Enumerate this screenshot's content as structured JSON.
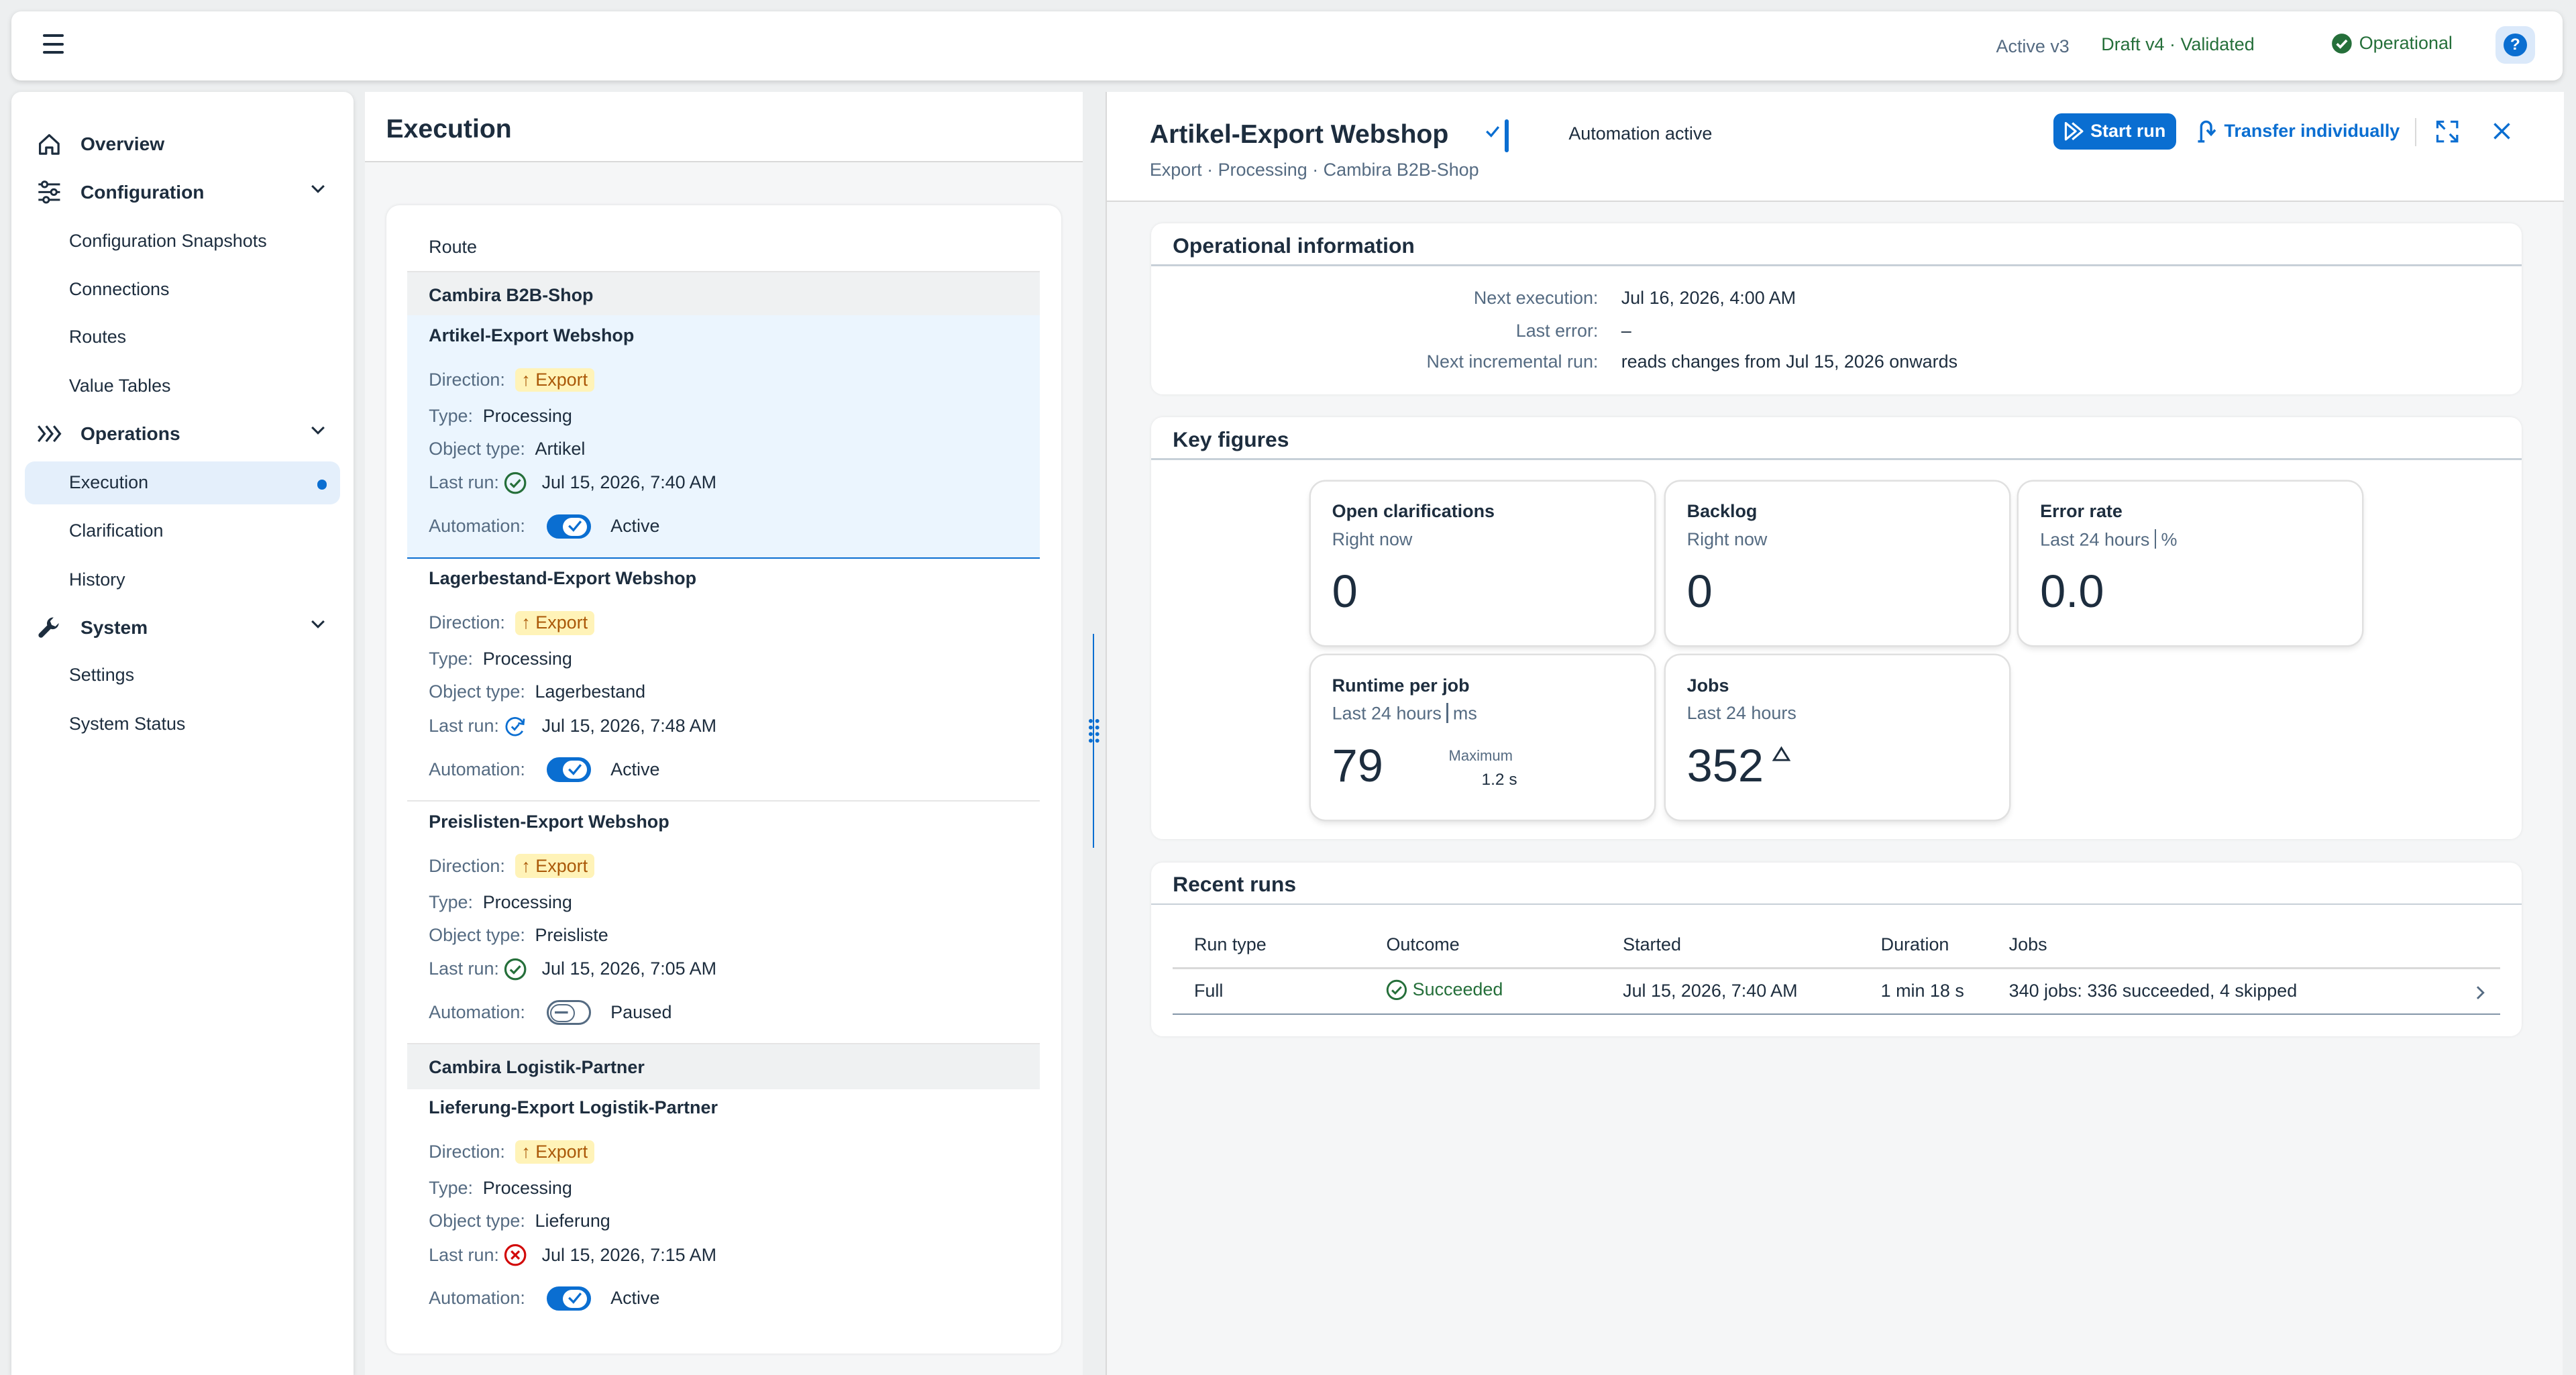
{
  "shell": {
    "active_version": "Active v3",
    "draft_version": "Draft v4 · Validated",
    "system_status": "Operational",
    "help": "?"
  },
  "nav": {
    "overview": "Overview",
    "configuration": "Configuration",
    "configuration_snapshots": "Configuration Snapshots",
    "connections": "Connections",
    "routes": "Routes",
    "value_tables": "Value Tables",
    "operations": "Operations",
    "execution": "Execution",
    "clarification": "Clarification",
    "history": "History",
    "system": "System",
    "settings": "Settings",
    "system_status": "System Status"
  },
  "execution": {
    "title": "Execution",
    "column_header": "Route",
    "labels": {
      "direction": "Direction:",
      "type": "Type:",
      "object_type": "Object type:",
      "last_run": "Last run:",
      "automation": "Automation:"
    },
    "groups": [
      {
        "name": "Cambira B2B-Shop",
        "routes": [
          {
            "title": "Artikel-Export Webshop",
            "direction": "↑ Export",
            "type": "Processing",
            "object_type": "Artikel",
            "last_run": "Jul 15, 2026, 7:40 AM",
            "last_run_status": "success",
            "automation": "Active"
          },
          {
            "title": "Lagerbestand-Export Webshop",
            "direction": "↑ Export",
            "type": "Processing",
            "object_type": "Lagerbestand",
            "last_run": "Jul 15, 2026, 7:48 AM",
            "last_run_status": "running",
            "automation": "Active"
          },
          {
            "title": "Preislisten-Export Webshop",
            "direction": "↑ Export",
            "type": "Processing",
            "object_type": "Preisliste",
            "last_run": "Jul 15, 2026, 7:05 AM",
            "last_run_status": "success",
            "automation": "Paused"
          }
        ]
      },
      {
        "name": "Cambira Logistik-Partner",
        "routes": [
          {
            "title": "Lieferung-Export Logistik-Partner",
            "direction": "↑ Export",
            "type": "Processing",
            "object_type": "Lieferung",
            "last_run": "Jul 15, 2026, 7:15 AM",
            "last_run_status": "error",
            "automation": "Active"
          }
        ]
      }
    ]
  },
  "detail": {
    "title": "Artikel-Export Webshop",
    "automation_label": "Automation active",
    "subtitle": "Export · Processing · Cambira B2B-Shop",
    "start_run": "Start run",
    "transfer_individually": "Transfer individually",
    "operational": {
      "title": "Operational information",
      "next_execution_label": "Next execution:",
      "next_execution": "Jul 16, 2026, 4:00 AM",
      "last_error_label": "Last error:",
      "last_error": "–",
      "next_incremental_label": "Next incremental run:",
      "next_incremental": "reads changes from Jul 15, 2026 onwards"
    },
    "key_figures": {
      "title": "Key figures",
      "open_clarifications": {
        "title": "Open clarifications",
        "sub": "Right now",
        "value": "0"
      },
      "backlog": {
        "title": "Backlog",
        "sub": "Right now",
        "value": "0"
      },
      "error_rate": {
        "title": "Error rate",
        "sub": "Last 24 hours",
        "unit": "%",
        "value": "0.0"
      },
      "runtime": {
        "title": "Runtime per job",
        "sub": "Last 24 hours",
        "unit": "ms",
        "value": "79",
        "max_label": "Maximum",
        "max_value": "1.2 s"
      },
      "jobs": {
        "title": "Jobs",
        "sub": "Last 24 hours",
        "value": "352",
        "trend": "up"
      }
    },
    "recent_runs": {
      "title": "Recent runs",
      "headers": [
        "Run type",
        "Outcome",
        "Started",
        "Duration",
        "Jobs"
      ],
      "rows": [
        {
          "run_type": "Full",
          "outcome": "Succeeded",
          "started": "Jul 15, 2026, 7:40 AM",
          "duration": "1 min 18 s",
          "jobs": "340 jobs: 336 succeeded, 4 skipped"
        }
      ]
    }
  },
  "colors": {
    "accent": "#0a6ed1",
    "success": "#256f3a",
    "error": "#d20a0a",
    "warning_bg": "#fff3b8",
    "warning_text": "#aa5808"
  }
}
